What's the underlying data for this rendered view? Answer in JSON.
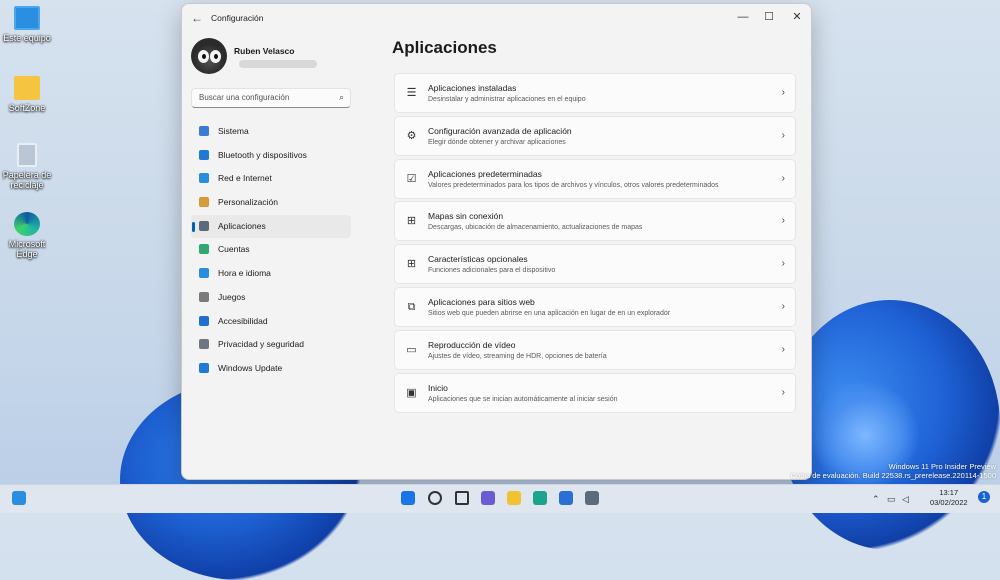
{
  "desktop": {
    "icons": [
      {
        "label": "Este equipo",
        "icon": "monitor-icon"
      },
      {
        "label": "SoftZone",
        "icon": "folder-icon"
      },
      {
        "label": "Papelera de reciclaje",
        "icon": "recycle-bin-icon"
      },
      {
        "label": "Microsoft Edge",
        "icon": "edge-icon"
      }
    ],
    "watermark": {
      "line1": "Windows 11 Pro Insider Preview",
      "line2": "Copia de evaluación. Build 22538.rs_prerelease.220114-1500"
    }
  },
  "window": {
    "title": "Configuración",
    "back_icon": "arrow-left-icon",
    "controls": {
      "minimize": "—",
      "maximize": "☐",
      "close": "✕"
    },
    "user": {
      "name": "Ruben Velasco"
    },
    "search": {
      "placeholder": "Buscar una configuración",
      "icon": "search-icon"
    },
    "nav": [
      {
        "label": "Sistema",
        "icon": "system-icon",
        "color": "#3a7bd5"
      },
      {
        "label": "Bluetooth y dispositivos",
        "icon": "bluetooth-icon",
        "color": "#1f7ad6"
      },
      {
        "label": "Red e Internet",
        "icon": "network-icon",
        "color": "#2a8de0"
      },
      {
        "label": "Personalización",
        "icon": "brush-icon",
        "color": "#d69a3a"
      },
      {
        "label": "Aplicaciones",
        "icon": "apps-icon",
        "color": "#5d6a7a",
        "active": true
      },
      {
        "label": "Cuentas",
        "icon": "account-icon",
        "color": "#2fa872"
      },
      {
        "label": "Hora e idioma",
        "icon": "globe-clock-icon",
        "color": "#2a8de0"
      },
      {
        "label": "Juegos",
        "icon": "gamepad-icon",
        "color": "#7a7a7a"
      },
      {
        "label": "Accesibilidad",
        "icon": "accessibility-icon",
        "color": "#1f6fd0"
      },
      {
        "label": "Privacidad y seguridad",
        "icon": "shield-icon",
        "color": "#6f7782"
      },
      {
        "label": "Windows Update",
        "icon": "update-icon",
        "color": "#1f7ad6"
      }
    ],
    "page_title": "Aplicaciones",
    "items": [
      {
        "title": "Aplicaciones instaladas",
        "desc": "Desinstalar y administrar aplicaciones en el equipo",
        "icon": "list-icon",
        "glyph": "☰"
      },
      {
        "title": "Configuración avanzada de aplicación",
        "desc": "Elegir dónde obtener y archivar aplicaciones",
        "icon": "app-settings-icon",
        "glyph": "⚙"
      },
      {
        "title": "Aplicaciones predeterminadas",
        "desc": "Valores predeterminados para los tipos de archivos y vínculos, otros valores predeterminados",
        "icon": "default-apps-icon",
        "glyph": "☑"
      },
      {
        "title": "Mapas sin conexión",
        "desc": "Descargas, ubicación de almacenamiento, actualizaciones de mapas",
        "icon": "map-icon",
        "glyph": "⊞"
      },
      {
        "title": "Características opcionales",
        "desc": "Funciones adicionales para el dispositivo",
        "icon": "optional-features-icon",
        "glyph": "⊞"
      },
      {
        "title": "Aplicaciones para sitios web",
        "desc": "Sitios web que pueden abrirse en una aplicación en lugar de en un explorador",
        "icon": "open-in-app-icon",
        "glyph": "⧉"
      },
      {
        "title": "Reproducción de vídeo",
        "desc": "Ajustes de vídeo, streaming de HDR, opciones de batería",
        "icon": "video-icon",
        "glyph": "▭"
      },
      {
        "title": "Inicio",
        "desc": "Aplicaciones que se inician automáticamente al iniciar sesión",
        "icon": "startup-icon",
        "glyph": "▣"
      }
    ],
    "chevron": "›"
  },
  "taskbar": {
    "apps": [
      {
        "icon": "widgets-icon",
        "color": "#2a8de0"
      },
      {
        "icon": "start-icon",
        "color": "#1a73e8"
      },
      {
        "icon": "search-icon",
        "color": "#333333"
      },
      {
        "icon": "task-view-icon",
        "color": "#333333"
      },
      {
        "icon": "chat-icon",
        "color": "#6b5bd6"
      },
      {
        "icon": "file-explorer-icon",
        "color": "#f2c230"
      },
      {
        "icon": "edge-icon",
        "color": "#1ca38c"
      },
      {
        "icon": "store-icon",
        "color": "#2a6fd6"
      },
      {
        "icon": "settings-icon",
        "color": "#5d6a7a"
      }
    ],
    "time": "13:17",
    "date": "03/02/2022",
    "notifications": "1"
  }
}
